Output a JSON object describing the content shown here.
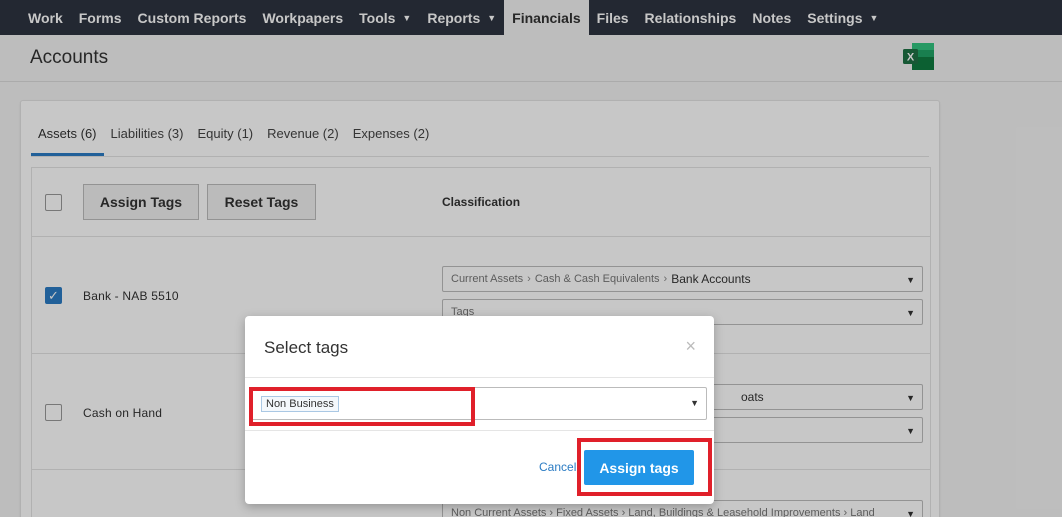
{
  "nav": {
    "items": [
      {
        "label": "Work",
        "caret": false,
        "active": false
      },
      {
        "label": "Forms",
        "caret": false,
        "active": false
      },
      {
        "label": "Custom Reports",
        "caret": false,
        "active": false
      },
      {
        "label": "Workpapers",
        "caret": false,
        "active": false
      },
      {
        "label": "Tools",
        "caret": true,
        "active": false
      },
      {
        "label": "Reports",
        "caret": true,
        "active": false
      },
      {
        "label": "Financials",
        "caret": false,
        "active": true
      },
      {
        "label": "Files",
        "caret": false,
        "active": false
      },
      {
        "label": "Relationships",
        "caret": false,
        "active": false
      },
      {
        "label": "Notes",
        "caret": false,
        "active": false
      },
      {
        "label": "Settings",
        "caret": true,
        "active": false
      }
    ],
    "caret_glyph": "▼"
  },
  "page": {
    "title": "Accounts",
    "excel_icon": "excel-icon",
    "excel_letter": "X"
  },
  "tabs": [
    {
      "label": "Assets (6)",
      "active": true
    },
    {
      "label": "Liabilities (3)",
      "active": false
    },
    {
      "label": "Equity (1)",
      "active": false
    },
    {
      "label": "Revenue (2)",
      "active": false
    },
    {
      "label": "Expenses (2)",
      "active": false
    }
  ],
  "table": {
    "assign_tags_label": "Assign Tags",
    "reset_tags_label": "Reset Tags",
    "classification_header": "Classification",
    "rows": [
      {
        "name": "Bank - NAB 5510",
        "checked": true,
        "classification_path": [
          "Current Assets",
          "Cash & Cash Equivalents"
        ],
        "classification_leaf": "Bank Accounts",
        "tags_placeholder": "Tags"
      },
      {
        "name": "Cash on Hand",
        "checked": false,
        "classification_visible": "oats"
      },
      {
        "name": "",
        "checked": false,
        "classification_visible": "Non Current Assets › Fixed Assets › Land, Buildings & Leasehold Improvements › Land"
      }
    ],
    "checkmark": "✓",
    "dropdown_glyph": "▼",
    "path_separator": "›"
  },
  "modal": {
    "title": "Select tags",
    "close_glyph": "×",
    "selected_tag": "Non Business",
    "cancel_label": "Cancel",
    "assign_label": "Assign tags"
  },
  "colors": {
    "nav_bg": "#2e3440",
    "accent_blue": "#2b7cc4",
    "button_blue": "#2196e8",
    "highlight_red": "#e0202a",
    "excel_green": "#1e7145"
  }
}
